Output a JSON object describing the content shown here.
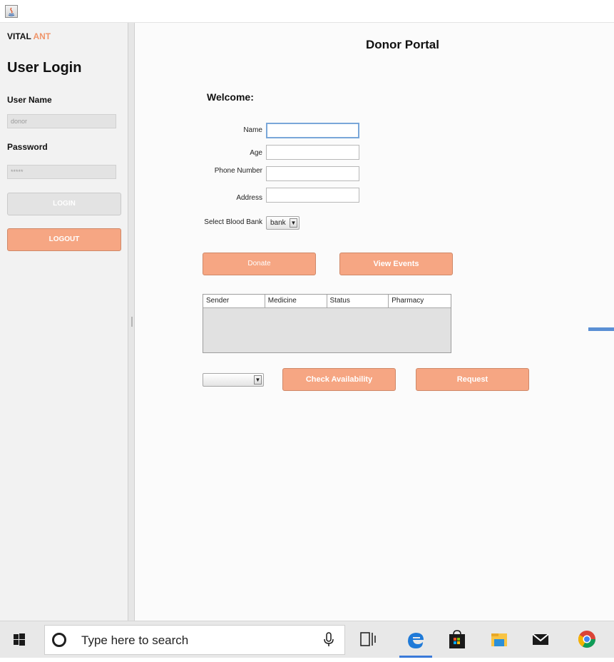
{
  "titlebar": {
    "app_icon": "java-icon"
  },
  "sidebar": {
    "brand_left": "VITAL",
    "brand_right": "ANT",
    "title": "User Login",
    "username_label": "User Name",
    "username_value": "donor",
    "password_label": "Password",
    "password_value": "*****",
    "login_label": "LOGIN",
    "logout_label": "LOGOUT"
  },
  "main": {
    "title": "Donor Portal",
    "welcome": "Welcome:",
    "fields": {
      "name": "Name",
      "age": "Age",
      "phone": "Phone Number",
      "address": "Address"
    },
    "blood_bank_label": "Select Blood Bank",
    "blood_bank_value": "bank",
    "donate_label": "Donate",
    "view_events_label": "View Events",
    "table_headers": [
      "Sender",
      "Medicine",
      "Status",
      "Pharmacy"
    ],
    "check_label": "Check Availability",
    "request_label": "Request"
  },
  "taskbar": {
    "search_placeholder": "Type here to search",
    "icons": [
      "windows-start-icon",
      "cortana-icon",
      "microphone-icon",
      "task-view-icon",
      "edge-icon",
      "store-icon",
      "file-explorer-icon",
      "mail-icon",
      "chrome-icon"
    ]
  },
  "colors": {
    "accent": "#f6a683",
    "brand_accent": "#f0956a",
    "focus": "#7aa7d9"
  }
}
